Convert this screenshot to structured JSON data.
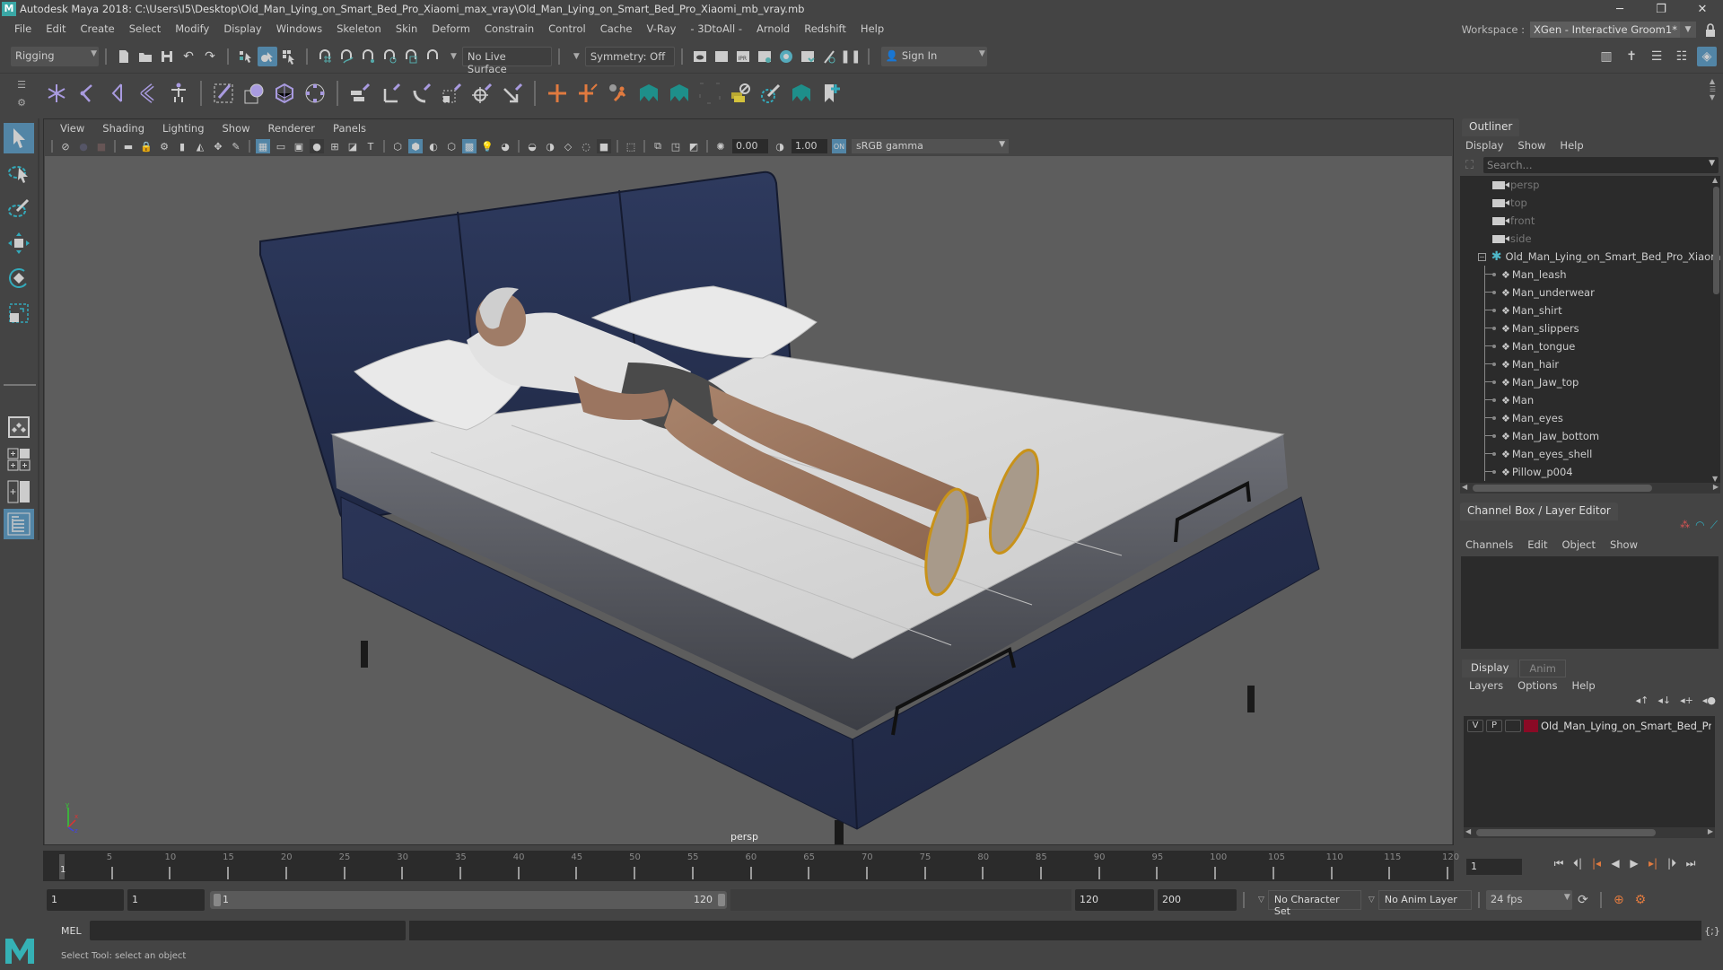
{
  "window": {
    "title": "Autodesk Maya 2018: C:\\Users\\I5\\Desktop\\Old_Man_Lying_on_Smart_Bed_Pro_Xiaomi_max_vray\\Old_Man_Lying_on_Smart_Bed_Pro_Xiaomi_mb_vray.mb",
    "logo": "M",
    "controls": {
      "minimize": "─",
      "restore": "❐",
      "close": "✕"
    }
  },
  "menubar": {
    "items": [
      "File",
      "Edit",
      "Create",
      "Select",
      "Modify",
      "Display",
      "Windows",
      "Skeleton",
      "Skin",
      "Deform",
      "Constrain",
      "Control",
      "Cache",
      "V-Ray",
      "- 3DtoAll -",
      "Arnold",
      "Redshift",
      "Help"
    ]
  },
  "workspace": {
    "label": "Workspace :",
    "value": "XGen - Interactive Groom1*"
  },
  "statusline": {
    "menuset": "Rigging",
    "live_surface": "No Live Surface",
    "symmetry": "Symmetry: Off",
    "sign_in": "Sign In"
  },
  "viewport": {
    "menu": [
      "View",
      "Shading",
      "Lighting",
      "Show",
      "Renderer",
      "Panels"
    ],
    "exposure": "0.00",
    "gamma": "1.00",
    "color_space": "sRGB gamma",
    "camera_label": "persp",
    "axis": {
      "y": "y",
      "x": "x",
      "z": "z"
    }
  },
  "outliner": {
    "title": "Outliner",
    "menu": [
      "Display",
      "Show",
      "Help"
    ],
    "search_placeholder": "Search...",
    "cameras": [
      "persp",
      "top",
      "front",
      "side"
    ],
    "root": "Old_Man_Lying_on_Smart_Bed_Pro_Xiaomi_",
    "children": [
      "Man_leash",
      "Man_underwear",
      "Man_shirt",
      "Man_slippers",
      "Man_tongue",
      "Man_hair",
      "Man_Jaw_top",
      "Man",
      "Man_eyes",
      "Man_Jaw_bottom",
      "Man_eyes_shell",
      "Pillow_p004"
    ]
  },
  "channel_box": {
    "title": "Channel Box / Layer Editor",
    "menu": [
      "Channels",
      "Edit",
      "Object",
      "Show"
    ]
  },
  "layer_editor": {
    "tabs": [
      "Display",
      "Anim"
    ],
    "menu": [
      "Layers",
      "Options",
      "Help"
    ],
    "layers": [
      {
        "v": "V",
        "p": "P",
        "color": "#8a0a25",
        "name": "Old_Man_Lying_on_Smart_Bed_Pro_X"
      }
    ]
  },
  "timeline": {
    "start": 1,
    "end": 120,
    "current_frame": "1",
    "tick_labels": [
      "5",
      "10",
      "15",
      "20",
      "25",
      "30",
      "35",
      "40",
      "45",
      "50",
      "55",
      "60",
      "65",
      "70",
      "75",
      "80",
      "85",
      "90",
      "95",
      "100",
      "105",
      "110",
      "115",
      "120"
    ]
  },
  "range": {
    "start_time": "1",
    "playback_start": "1",
    "slider_start": "1",
    "slider_end": "120",
    "playback_end": "120",
    "end_time": "200",
    "character_set": "No Character Set",
    "anim_layer": "No Anim Layer",
    "fps": "24 fps"
  },
  "command_line": {
    "language": "MEL"
  },
  "help_line": {
    "text": "Select Tool: select an object"
  },
  "colors": {
    "accent": "#5285a6",
    "viewport_bg": "#5d5d5d",
    "panel_bg": "#444444",
    "field_bg": "#2b2b2b",
    "layer_color": "#8a0a25"
  }
}
